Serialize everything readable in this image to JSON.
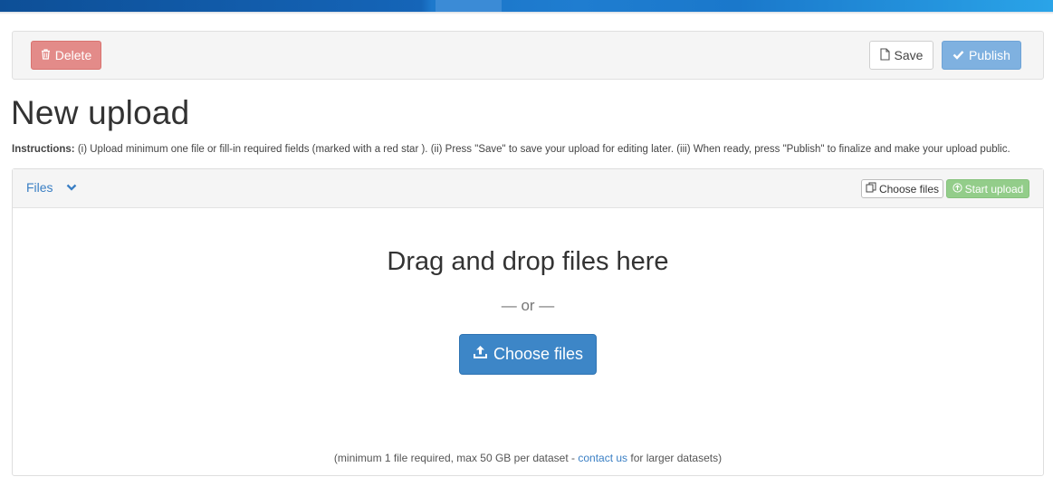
{
  "toolbar": {
    "delete_label": "Delete",
    "save_label": "Save",
    "publish_label": "Publish"
  },
  "page": {
    "title": "New upload",
    "instructions_prefix": "Instructions:",
    "instructions_text": " (i) Upload minimum one file or fill-in required fields (marked with a red star ). (ii) Press \"Save\" to save your upload for editing later. (iii) When ready, press \"Publish\" to finalize and make your upload public."
  },
  "files_panel": {
    "header_label": "Files",
    "choose_files_small": "Choose files",
    "start_upload": "Start upload",
    "drop_title": "Drag and drop files here",
    "drop_or": "— or —",
    "choose_files_large": "Choose files",
    "note_before": "(minimum 1 file required, max 50 GB per dataset - ",
    "note_link": "contact us",
    "note_after": " for larger datasets)"
  },
  "colors": {
    "primary": "#3d86c7",
    "danger": "#e38b89",
    "success": "#93cd8a",
    "link": "#3a7fc4"
  },
  "icons": {
    "delete": "trash-icon",
    "save": "file-icon",
    "publish": "check-icon",
    "toggle": "chevron-down-icon",
    "choose_small": "copy-icon",
    "start": "upload-circle-icon",
    "choose_large": "upload-icon"
  }
}
